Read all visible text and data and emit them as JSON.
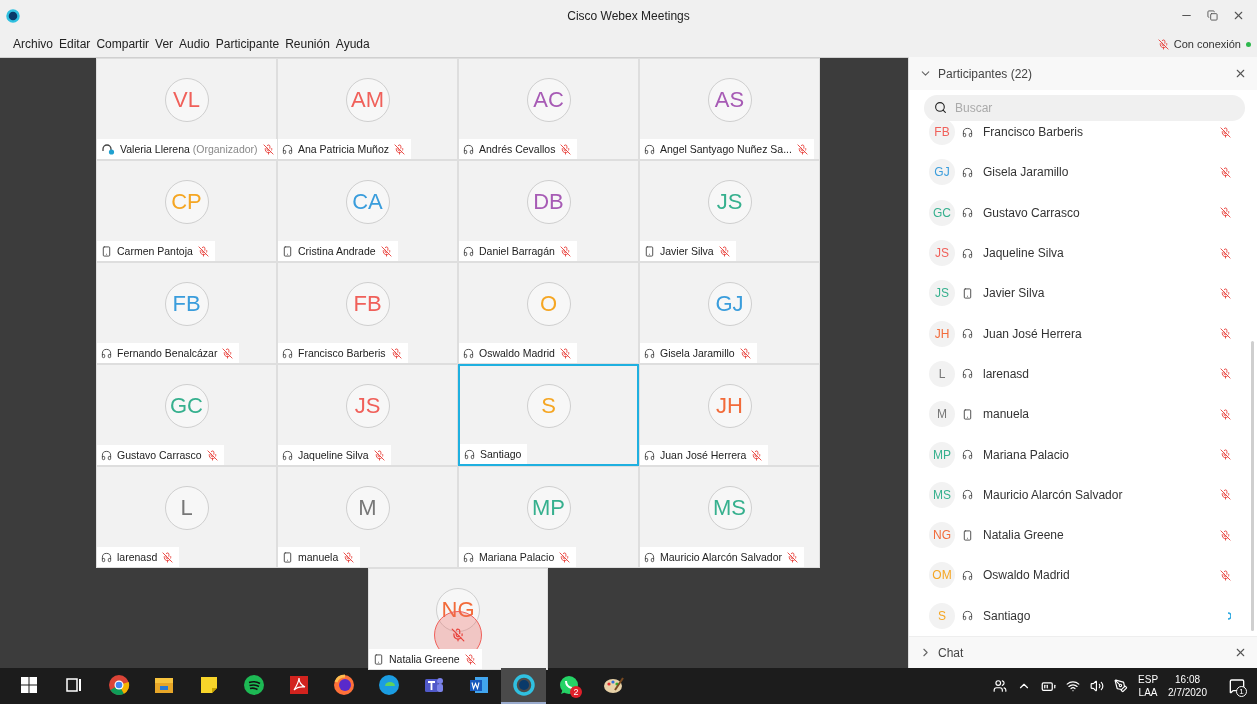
{
  "window": {
    "title": "Cisco Webex Meetings"
  },
  "menu": [
    "Archivo",
    "Editar",
    "Compartir",
    "Ver",
    "Audio",
    "Participante",
    "Reunión",
    "Ayuda"
  ],
  "connection": {
    "label": "Con conexión",
    "color": "#2db84d"
  },
  "tiles": [
    {
      "initials": "VL",
      "color": "#f0605a",
      "name": "Valeria Llerena",
      "role": "(Organizador)",
      "kind": "organizer",
      "muted": true,
      "selected": false,
      "mute_overlay": false
    },
    {
      "initials": "AM",
      "color": "#f0605a",
      "name": "Ana Patricia Muñoz",
      "kind": "headset",
      "muted": true,
      "selected": false,
      "mute_overlay": false
    },
    {
      "initials": "AC",
      "color": "#a75bb5",
      "name": "Andrés Cevallos",
      "kind": "headset",
      "muted": true,
      "selected": false,
      "mute_overlay": false
    },
    {
      "initials": "AS",
      "color": "#a75bb5",
      "name": "Angel Santyago Nuñez Sa...",
      "kind": "headset",
      "muted": true,
      "selected": false,
      "mute_overlay": false
    },
    {
      "initials": "CP",
      "color": "#f5a623",
      "name": "Carmen Pantoja",
      "kind": "phone",
      "muted": true,
      "selected": false,
      "mute_overlay": false
    },
    {
      "initials": "CA",
      "color": "#3a9ddc",
      "name": "Cristina Andrade",
      "kind": "phone",
      "muted": true,
      "selected": false,
      "mute_overlay": false
    },
    {
      "initials": "DB",
      "color": "#a75bb5",
      "name": "Daniel Barragán",
      "kind": "headset",
      "muted": true,
      "selected": false,
      "mute_overlay": false
    },
    {
      "initials": "JS",
      "color": "#36b08e",
      "name": "Javier Silva",
      "kind": "phone",
      "muted": true,
      "selected": false,
      "mute_overlay": false
    },
    {
      "initials": "FB",
      "color": "#3a9ddc",
      "name": "Fernando Benalcázar",
      "kind": "headset",
      "muted": true,
      "selected": false,
      "mute_overlay": false
    },
    {
      "initials": "FB",
      "color": "#f0605a",
      "name": "Francisco Barberis",
      "kind": "headset",
      "muted": true,
      "selected": false,
      "mute_overlay": false
    },
    {
      "initials": "O",
      "color": "#f5a623",
      "name": "Oswaldo Madrid",
      "kind": "headset",
      "muted": true,
      "selected": false,
      "mute_overlay": false
    },
    {
      "initials": "GJ",
      "color": "#3a9ddc",
      "name": "Gisela Jaramillo",
      "kind": "headset",
      "muted": true,
      "selected": false,
      "mute_overlay": false
    },
    {
      "initials": "GC",
      "color": "#36b08e",
      "name": "Gustavo Carrasco",
      "kind": "headset",
      "muted": true,
      "selected": false,
      "mute_overlay": false
    },
    {
      "initials": "JS",
      "color": "#f0605a",
      "name": "Jaqueline Silva",
      "kind": "headset",
      "muted": true,
      "selected": false,
      "mute_overlay": false
    },
    {
      "initials": "S",
      "color": "#f5a623",
      "name": "Santiago",
      "kind": "headset",
      "muted": false,
      "selected": true,
      "mute_overlay": false
    },
    {
      "initials": "JH",
      "color": "#f26b3a",
      "name": "Juan José Herrera",
      "kind": "headset",
      "muted": true,
      "selected": false,
      "mute_overlay": false
    },
    {
      "initials": "L",
      "color": "#777777",
      "name": "larenasd",
      "kind": "headset",
      "muted": true,
      "selected": false,
      "mute_overlay": false
    },
    {
      "initials": "M",
      "color": "#777777",
      "name": "manuela",
      "kind": "phone",
      "muted": true,
      "selected": false,
      "mute_overlay": false
    },
    {
      "initials": "MP",
      "color": "#36b08e",
      "name": "Mariana Palacio",
      "kind": "headset",
      "muted": true,
      "selected": false,
      "mute_overlay": false
    },
    {
      "initials": "MS",
      "color": "#36b08e",
      "name": "Mauricio Alarcón Salvador",
      "kind": "headset",
      "muted": true,
      "selected": false,
      "mute_overlay": false
    },
    {
      "initials": "NG",
      "color": "#f26b3a",
      "name": "Natalia Greene",
      "kind": "phone",
      "muted": true,
      "selected": false,
      "mute_overlay": true
    }
  ],
  "panel": {
    "title": "Participantes (22)",
    "search": {
      "placeholder": "Buscar"
    },
    "participants": [
      {
        "initials": "FB",
        "color": "#f0605a",
        "name": "Francisco Barberis",
        "kind": "headset",
        "muted": true
      },
      {
        "initials": "GJ",
        "color": "#3a9ddc",
        "name": "Gisela Jaramillo",
        "kind": "headset",
        "muted": true
      },
      {
        "initials": "GC",
        "color": "#36b08e",
        "name": "Gustavo Carrasco",
        "kind": "headset",
        "muted": true
      },
      {
        "initials": "JS",
        "color": "#f0605a",
        "name": "Jaqueline Silva",
        "kind": "headset",
        "muted": true
      },
      {
        "initials": "JS",
        "color": "#36b08e",
        "name": "Javier Silva",
        "kind": "phone",
        "muted": true
      },
      {
        "initials": "JH",
        "color": "#f26b3a",
        "name": "Juan José Herrera",
        "kind": "headset",
        "muted": true
      },
      {
        "initials": "L",
        "color": "#777777",
        "name": "larenasd",
        "kind": "headset",
        "muted": true
      },
      {
        "initials": "M",
        "color": "#777777",
        "name": "manuela",
        "kind": "phone",
        "muted": true
      },
      {
        "initials": "MP",
        "color": "#36b08e",
        "name": "Mariana Palacio",
        "kind": "headset",
        "muted": true
      },
      {
        "initials": "MS",
        "color": "#36b08e",
        "name": "Mauricio Alarcón Salvador",
        "kind": "headset",
        "muted": true
      },
      {
        "initials": "NG",
        "color": "#f26b3a",
        "name": "Natalia Greene",
        "kind": "phone",
        "muted": true
      },
      {
        "initials": "OM",
        "color": "#f5a623",
        "name": "Oswaldo Madrid",
        "kind": "headset",
        "muted": true
      },
      {
        "initials": "S",
        "color": "#f5a623",
        "name": "Santiago",
        "kind": "headset",
        "muted": false
      }
    ],
    "chat": {
      "title": "Chat",
      "expanded": false
    }
  },
  "taskbar": {
    "apps": [
      {
        "kind": "taskview",
        "selected": false
      },
      {
        "kind": "chrome",
        "selected": false
      },
      {
        "kind": "explorer",
        "selected": false
      },
      {
        "kind": "sticky",
        "selected": false
      },
      {
        "kind": "spotify",
        "selected": false
      },
      {
        "kind": "acrobat",
        "selected": false
      },
      {
        "kind": "firefox",
        "selected": false
      },
      {
        "kind": "edge",
        "selected": false
      },
      {
        "kind": "teams",
        "selected": false
      },
      {
        "kind": "word",
        "selected": false
      },
      {
        "kind": "webex",
        "selected": true
      },
      {
        "kind": "whatsapp",
        "selected": false,
        "badge": "2"
      },
      {
        "kind": "paint",
        "selected": false
      }
    ],
    "language": [
      "ESP",
      "LAA"
    ],
    "time": "16:08",
    "date": "2/7/2020",
    "notifications": "1"
  }
}
